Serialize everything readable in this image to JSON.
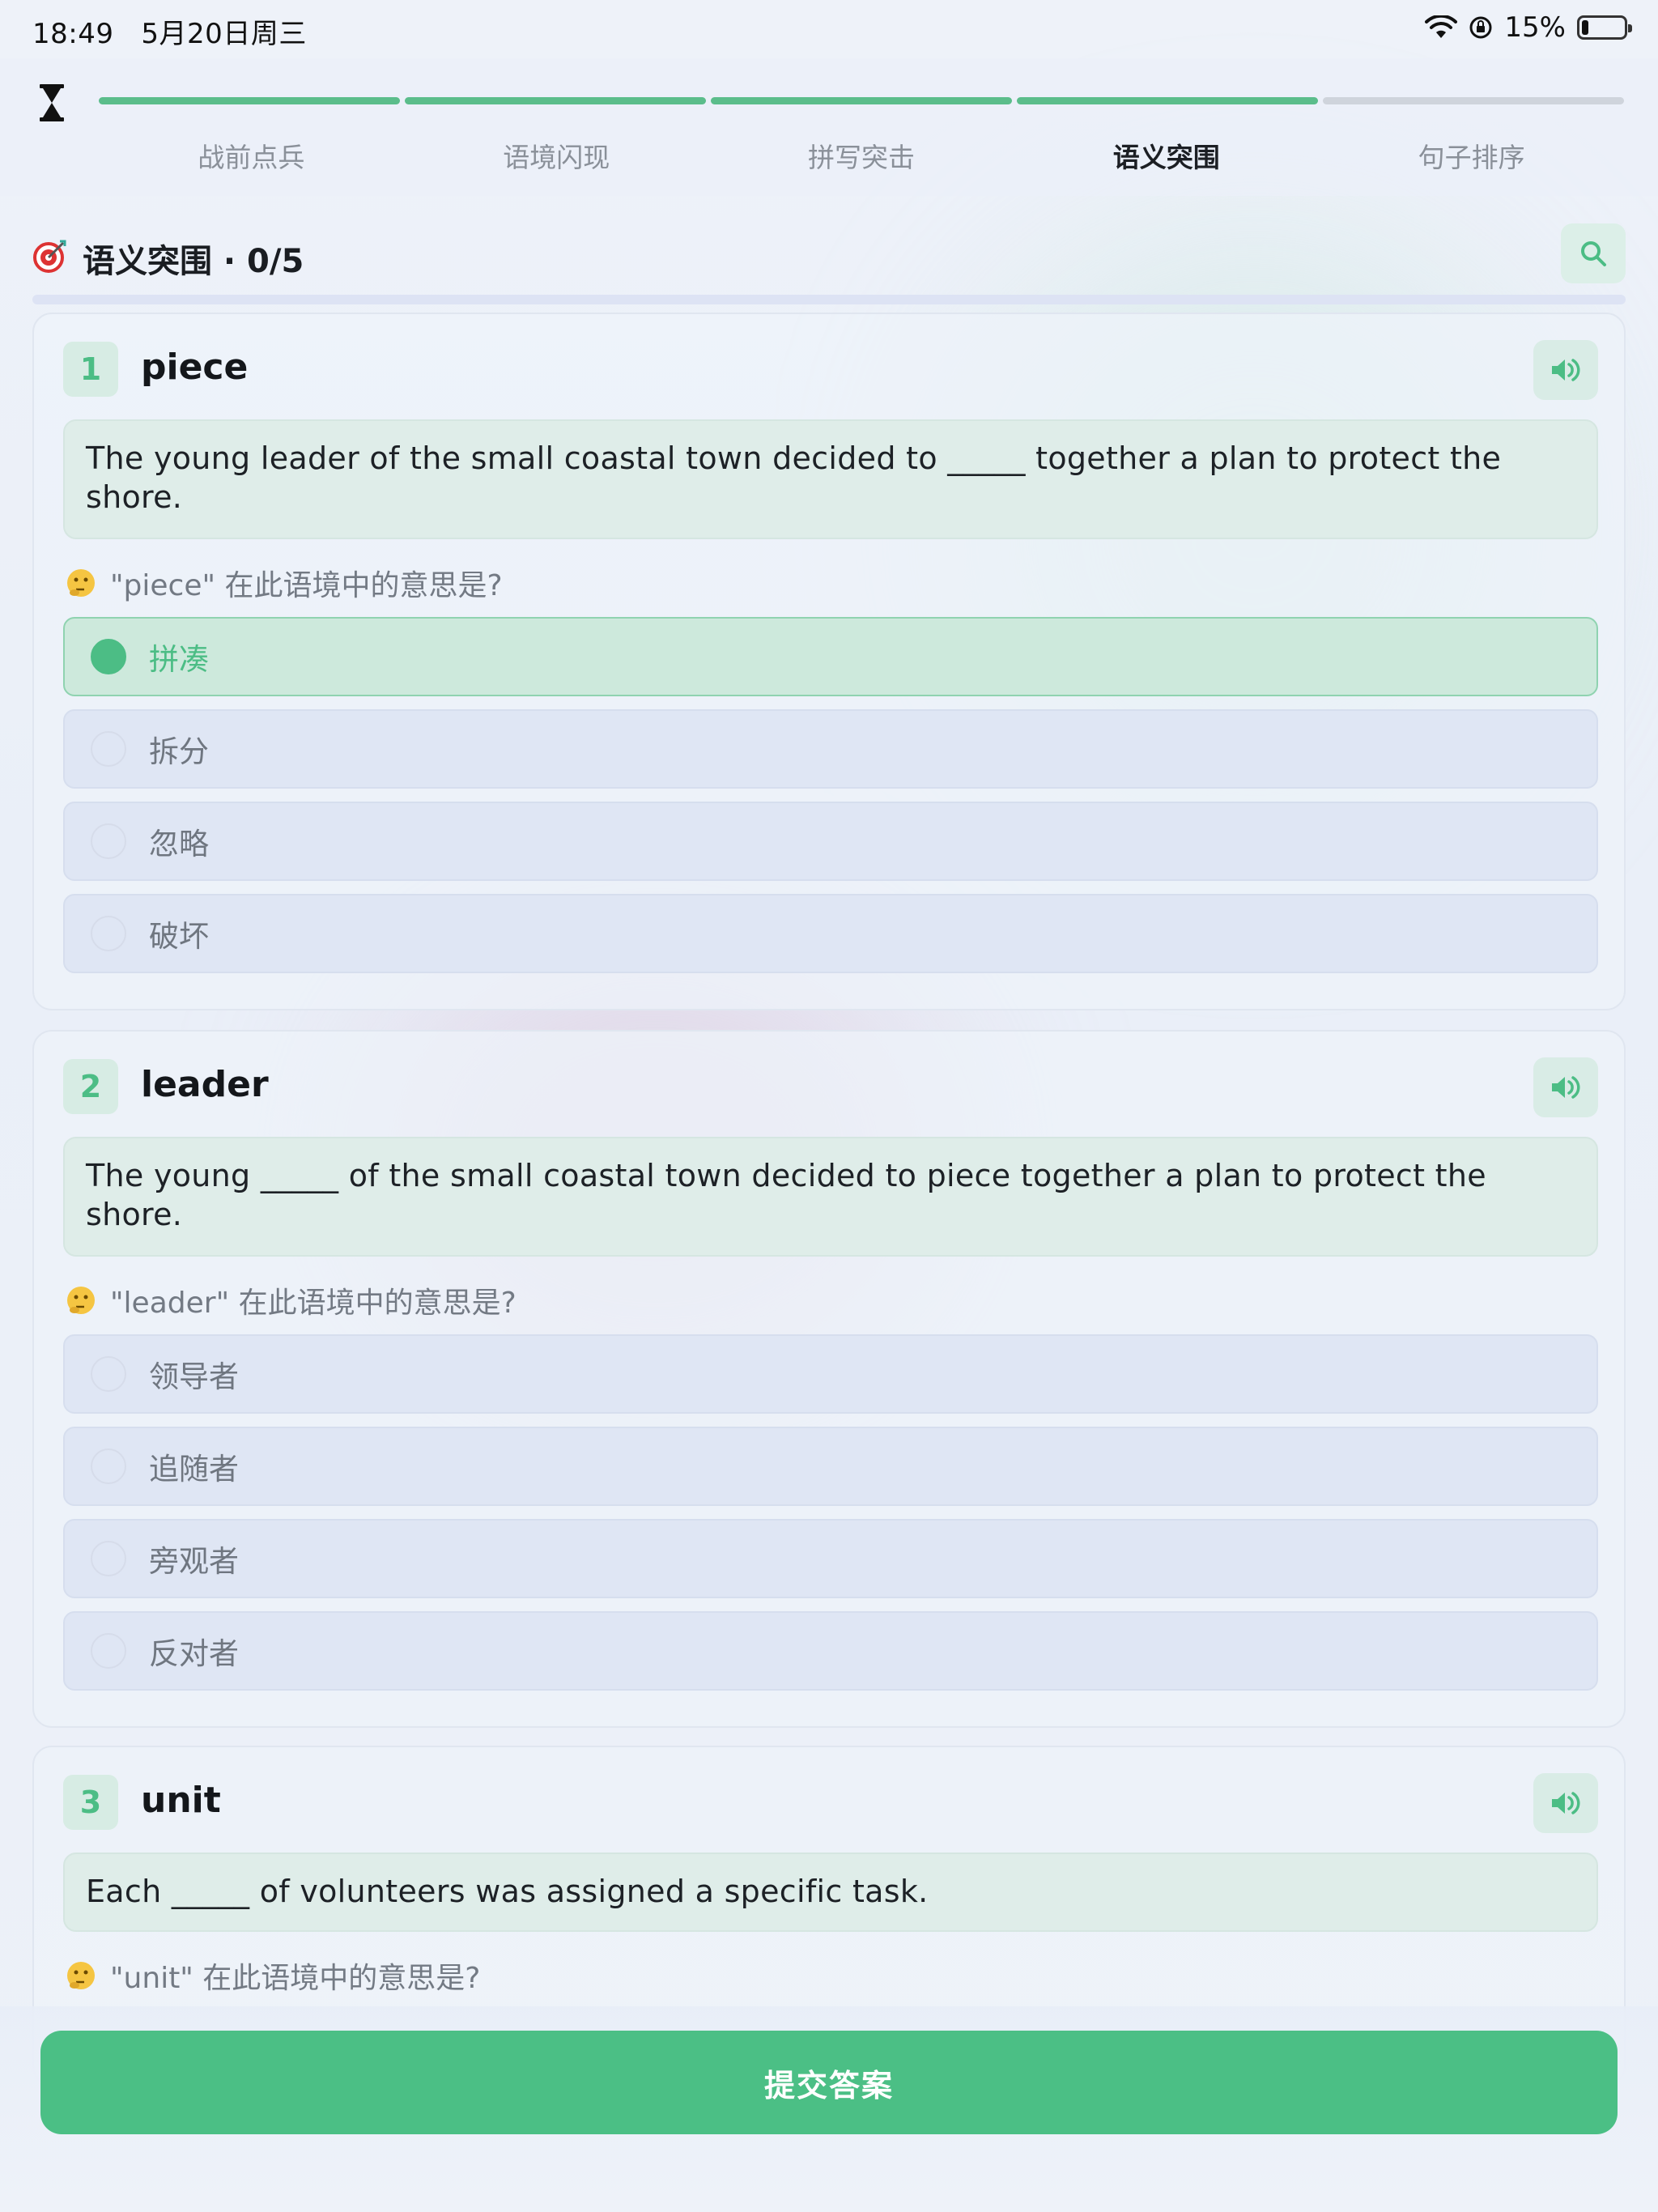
{
  "status_bar": {
    "time": "18:49",
    "date": "5月20日周三",
    "battery": "15%"
  },
  "progress": {
    "completed_segments": 4,
    "total_segments": 5,
    "steps": [
      "战前点兵",
      "语境闪现",
      "拼写突击",
      "语义突围",
      "句子排序"
    ],
    "active_step": 3
  },
  "section": {
    "title": "语义突围 · 0/5"
  },
  "questions": [
    {
      "number": "1",
      "word": "piece",
      "sentence": "The young leader of the small coastal town decided to _____ together a plan to protect the shore.",
      "prompt": "\"piece\" 在此语境中的意思是?",
      "options": [
        "拼凑",
        "拆分",
        "忽略",
        "破坏"
      ],
      "selected": 0
    },
    {
      "number": "2",
      "word": "leader",
      "sentence": "The young _____ of the small coastal town decided to piece together a plan to protect the shore.",
      "prompt": "\"leader\" 在此语境中的意思是?",
      "options": [
        "领导者",
        "追随者",
        "旁观者",
        "反对者"
      ],
      "selected": -1
    },
    {
      "number": "3",
      "word": "unit",
      "sentence": "Each _____ of volunteers was assigned a specific task.",
      "prompt": "\"unit\" 在此语境中的意思是?",
      "options": [],
      "selected": -1
    }
  ],
  "submit": {
    "label": "提交答案"
  },
  "colors": {
    "accent": "#4bbf85",
    "badge_bg": "#d7ece4",
    "option_bg": "#dfe6f4",
    "selected_bg": "#cde9dc"
  },
  "icons": {
    "header": "hourglass-icon",
    "section": "target-icon",
    "search": "search-icon",
    "audio": "speaker-icon",
    "prompt": "thinking-face-icon"
  }
}
